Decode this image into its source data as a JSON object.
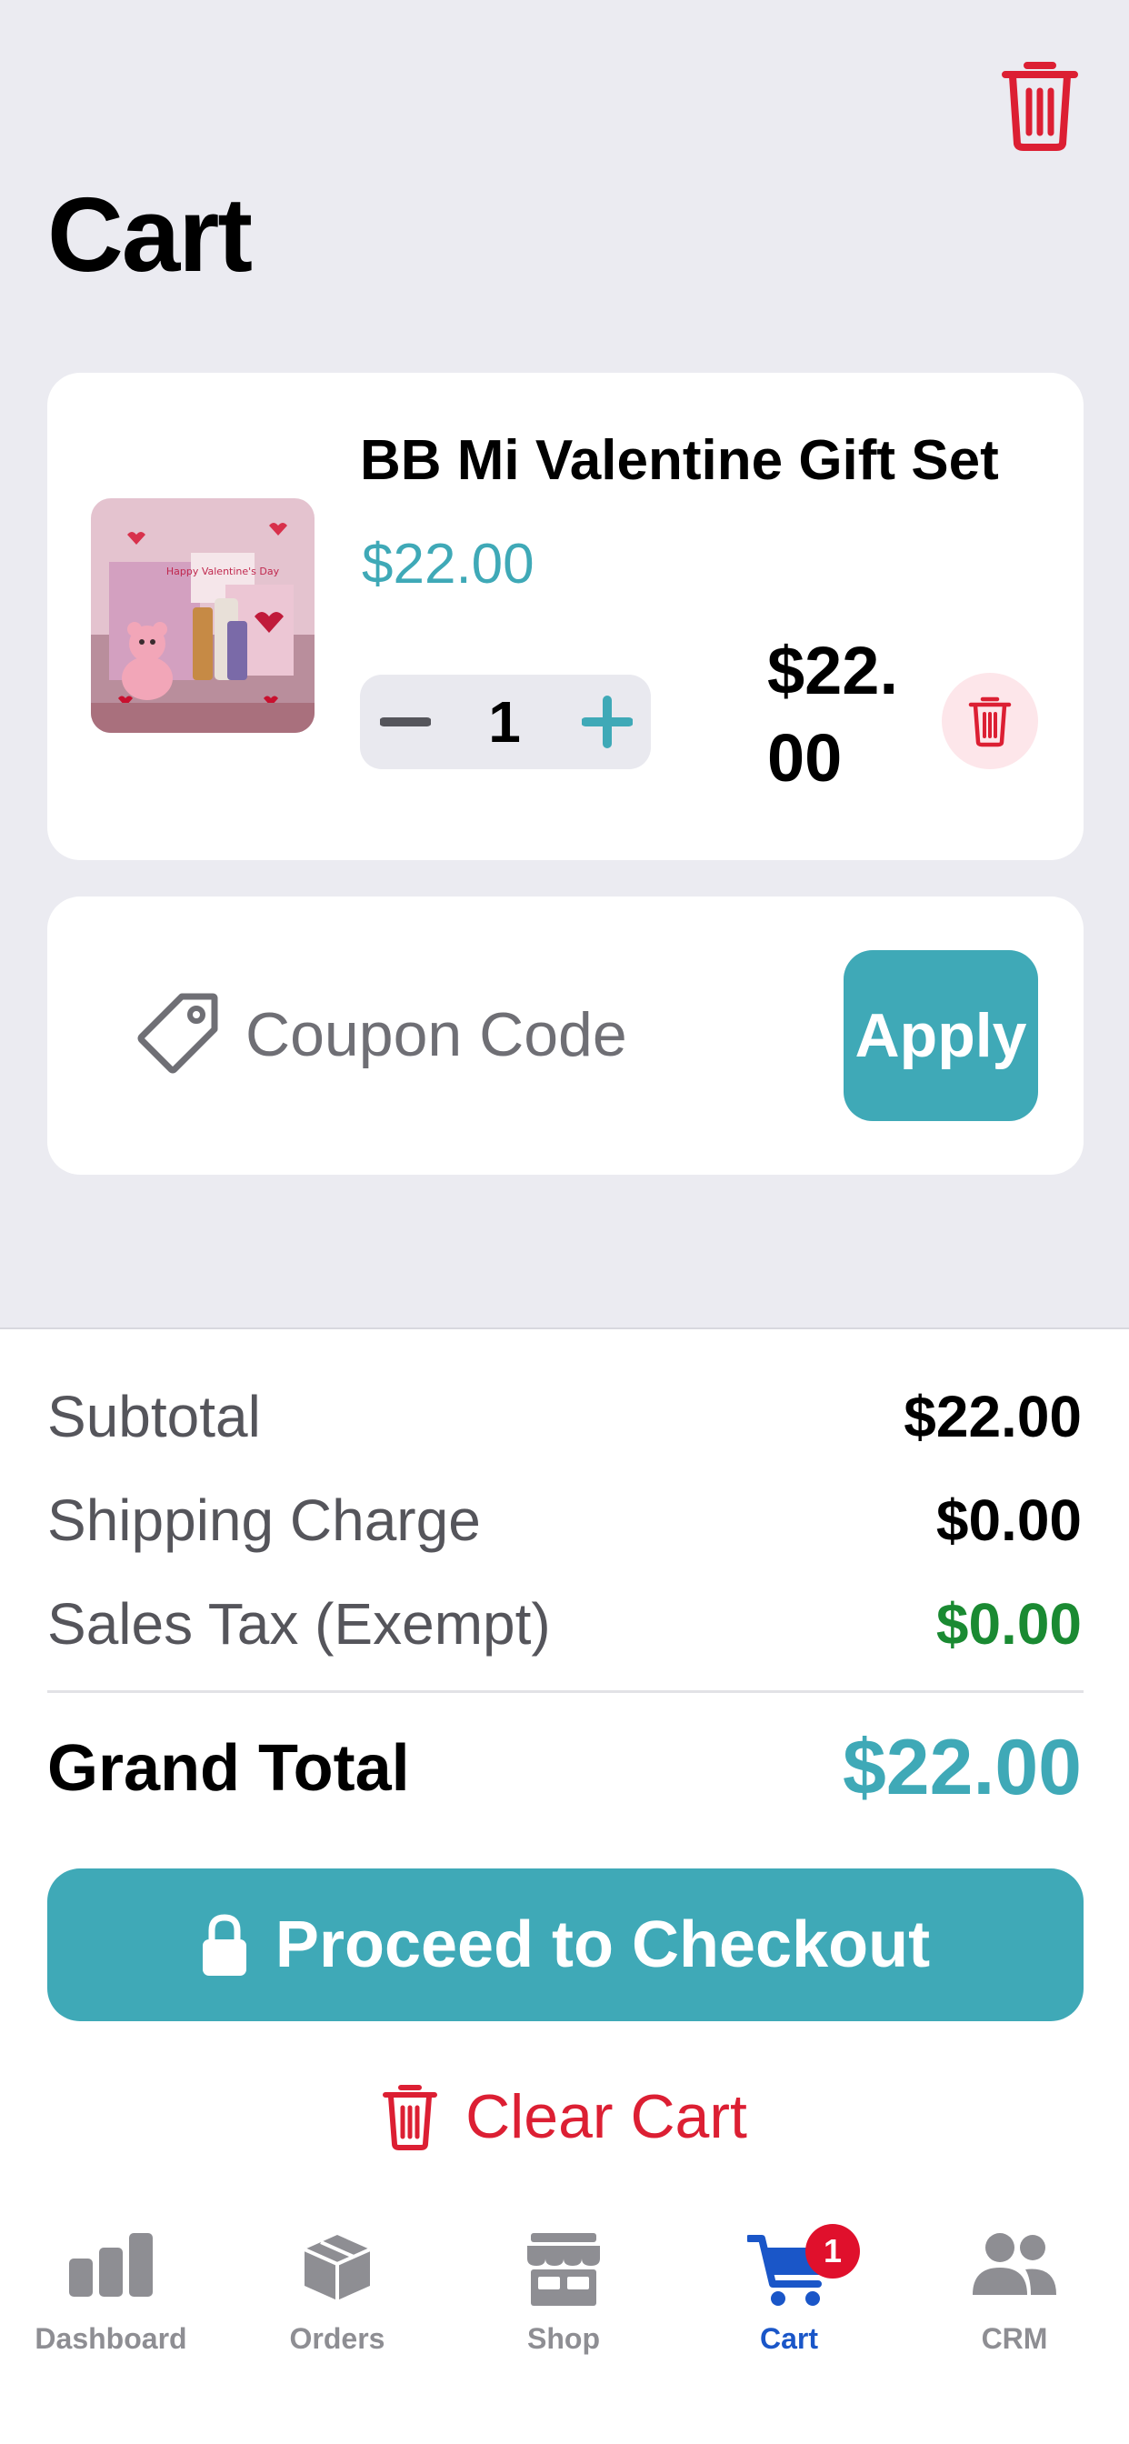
{
  "header": {
    "title": "Cart"
  },
  "cart_item": {
    "name": "BB Mi Valentine Gift Set",
    "unit_price": "$22.00",
    "quantity": "1",
    "line_total": "$22.00",
    "image_text": "Happy Valentine's Day"
  },
  "coupon": {
    "placeholder": "Coupon Code",
    "apply_label": "Apply"
  },
  "summary": {
    "subtotal_label": "Subtotal",
    "subtotal_value": "$22.00",
    "shipping_label": "Shipping Charge",
    "shipping_value": "$0.00",
    "tax_label": "Sales Tax (Exempt)",
    "tax_value": "$0.00",
    "grand_total_label": "Grand Total",
    "grand_total_value": "$22.00"
  },
  "actions": {
    "checkout_label": "Proceed to Checkout",
    "clear_label": "Clear Cart"
  },
  "tabs": [
    {
      "label": "Dashboard",
      "icon": "bar-chart-icon",
      "active": false
    },
    {
      "label": "Orders",
      "icon": "box-icon",
      "active": false
    },
    {
      "label": "Shop",
      "icon": "store-icon",
      "active": false
    },
    {
      "label": "Cart",
      "icon": "cart-icon",
      "active": true,
      "badge": "1"
    },
    {
      "label": "CRM",
      "icon": "people-icon",
      "active": false
    }
  ],
  "colors": {
    "accent": "#3fa9b7",
    "destructive": "#dc1f33",
    "success": "#1a8a32",
    "tab_active": "#1a56c8",
    "background": "#ebebf1"
  }
}
